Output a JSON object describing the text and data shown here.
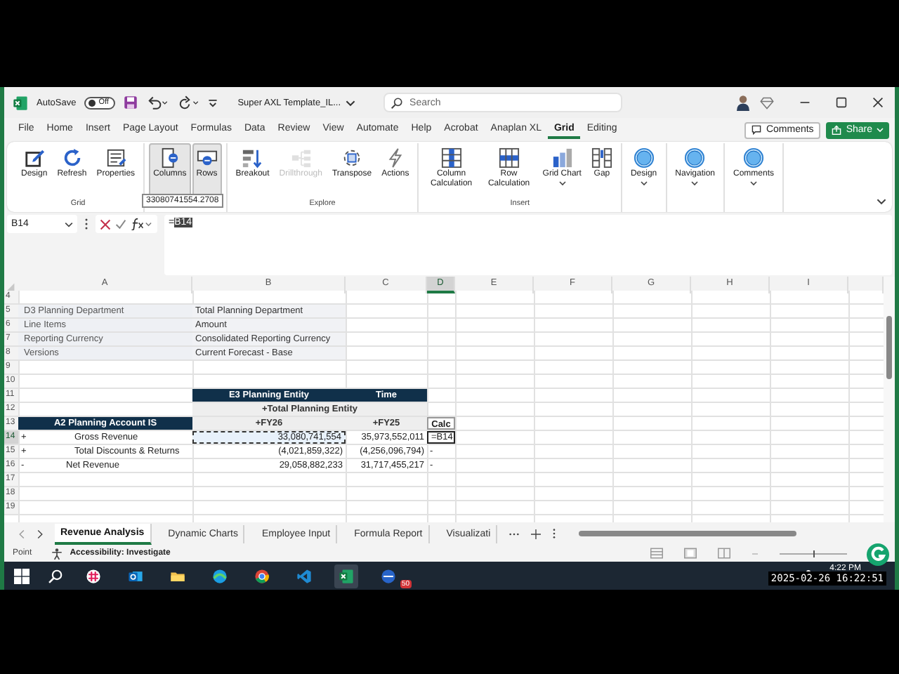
{
  "window": {
    "title": "Super AXL Template_IL...",
    "autosave": {
      "label": "AutoSave",
      "on": false,
      "state_label": "Off"
    },
    "search": {
      "placeholder": "Search"
    }
  },
  "menu": [
    {
      "label": "File",
      "selected": false
    },
    {
      "label": "Home",
      "selected": false
    },
    {
      "label": "Insert",
      "selected": false
    },
    {
      "label": "Page Layout",
      "selected": false
    },
    {
      "label": "Formulas",
      "selected": false
    },
    {
      "label": "Data",
      "selected": false
    },
    {
      "label": "Review",
      "selected": false
    },
    {
      "label": "View",
      "selected": false
    },
    {
      "label": "Automate",
      "selected": false
    },
    {
      "label": "Help",
      "selected": false
    },
    {
      "label": "Acrobat",
      "selected": false
    },
    {
      "label": "Anaplan XL",
      "selected": false
    },
    {
      "label": "Grid",
      "selected": true
    },
    {
      "label": "Editing",
      "selected": false
    }
  ],
  "header_buttons": [
    {
      "label": "Comments",
      "kind": "outline"
    },
    {
      "label": "Share",
      "kind": "primary"
    }
  ],
  "ribbon": {
    "groups": [
      {
        "label": "Grid",
        "items": [
          {
            "label": "Design",
            "disabled": false,
            "pressed": false,
            "dropdown": false
          },
          {
            "label": "Refresh",
            "disabled": false,
            "pressed": false,
            "dropdown": false
          },
          {
            "label": "Properties",
            "disabled": false,
            "pressed": false,
            "dropdown": false
          }
        ]
      },
      {
        "items": [
          {
            "label": "Columns",
            "disabled": false,
            "pressed": true,
            "dropdown": false
          },
          {
            "label": "Rows",
            "disabled": false,
            "pressed": true,
            "dropdown": false
          }
        ]
      },
      {
        "label": "Explore",
        "items": [
          {
            "label": "Breakout",
            "disabled": false,
            "pressed": false,
            "dropdown": false
          },
          {
            "label": "Drillthrough",
            "disabled": true,
            "pressed": false,
            "dropdown": false
          },
          {
            "label": "Transpose",
            "disabled": false,
            "pressed": false,
            "dropdown": false
          },
          {
            "label": "Actions",
            "disabled": false,
            "pressed": false,
            "dropdown": false
          }
        ]
      },
      {
        "label": "Insert",
        "items": [
          {
            "label": "Column Calculation",
            "disabled": false,
            "pressed": false,
            "dropdown": false
          },
          {
            "label": "Row Calculation",
            "disabled": false,
            "pressed": false,
            "dropdown": false
          },
          {
            "label": "Grid Chart",
            "disabled": false,
            "pressed": false,
            "dropdown": true
          },
          {
            "label": "Gap",
            "disabled": false,
            "pressed": false,
            "dropdown": false
          }
        ]
      },
      {
        "items": [
          {
            "label": "Design",
            "disabled": false,
            "pressed": false,
            "dropdown": true
          }
        ]
      },
      {
        "items": [
          {
            "label": "Navigation",
            "disabled": false,
            "pressed": false,
            "dropdown": true
          }
        ]
      },
      {
        "items": [
          {
            "label": "Comments",
            "disabled": false,
            "pressed": false,
            "dropdown": true
          }
        ]
      }
    ]
  },
  "tooltip": "33080741554.2708",
  "formula_bar": {
    "name_box": "B14",
    "formula": [
      {
        "text": "=",
        "selected": false
      },
      {
        "text": "B14",
        "selected": true
      }
    ]
  },
  "sheet": {
    "columns": [
      {
        "label": "A",
        "selected": false
      },
      {
        "label": "B",
        "selected": false
      },
      {
        "label": "C",
        "selected": false
      },
      {
        "label": "D",
        "selected": true
      },
      {
        "label": "E",
        "selected": false
      },
      {
        "label": "F",
        "selected": false
      },
      {
        "label": "G",
        "selected": false
      },
      {
        "label": "H",
        "selected": false
      },
      {
        "label": "I",
        "selected": false
      }
    ],
    "rows": [
      {
        "number": "4",
        "selected": false
      },
      {
        "number": "5",
        "selected": false,
        "A": {
          "kind": "label",
          "text": "D3 Planning Department"
        },
        "B": {
          "kind": "value",
          "text": "Total Planning Department"
        }
      },
      {
        "number": "6",
        "selected": false,
        "A": {
          "kind": "label",
          "text": "Line Items"
        },
        "B": {
          "kind": "value",
          "text": "Amount"
        }
      },
      {
        "number": "7",
        "selected": false,
        "A": {
          "kind": "label",
          "text": "Reporting Currency"
        },
        "B": {
          "kind": "value",
          "text": "Consolidated Reporting Currency"
        }
      },
      {
        "number": "8",
        "selected": false,
        "A": {
          "kind": "label",
          "text": "Versions"
        },
        "B": {
          "kind": "value",
          "text": "Current Forecast - Base"
        }
      },
      {
        "number": "9",
        "selected": false
      },
      {
        "number": "10",
        "selected": false
      },
      {
        "number": "11",
        "selected": false,
        "B": {
          "kind": "dim-header",
          "text": "E3 Planning Entity"
        },
        "C": {
          "kind": "dim-header",
          "text": "Time"
        }
      },
      {
        "number": "12",
        "selected": false,
        "B": {
          "kind": "member-wide",
          "text": "+Total Planning Entity"
        }
      },
      {
        "number": "13",
        "selected": false,
        "A": {
          "kind": "dim-header",
          "text": "A2 Planning Account IS"
        },
        "B": {
          "kind": "member",
          "text": "+FY26"
        },
        "C": {
          "kind": "member",
          "text": "+FY25"
        },
        "D": {
          "kind": "calc-header",
          "text": "Calc"
        }
      },
      {
        "number": "14",
        "selected": true,
        "A": {
          "kind": "account-detail",
          "marker": "+",
          "text": "Gross Revenue"
        },
        "B": {
          "kind": "number",
          "text": "33,080,741,554",
          "referenced": true
        },
        "C": {
          "kind": "number",
          "text": "35,973,552,011"
        },
        "D": {
          "kind": "calc",
          "text": "=B14",
          "editing": true
        }
      },
      {
        "number": "15",
        "selected": false,
        "A": {
          "kind": "account-detail",
          "marker": "+",
          "text": "Total Discounts & Returns"
        },
        "B": {
          "kind": "number",
          "text": "(4,021,859,322)"
        },
        "C": {
          "kind": "number",
          "text": "(4,256,096,794)"
        },
        "D": {
          "kind": "calc",
          "text": "-"
        }
      },
      {
        "number": "16",
        "selected": false,
        "A": {
          "kind": "account-total",
          "marker": "-",
          "text": "Net Revenue"
        },
        "B": {
          "kind": "number",
          "text": "29,058,882,233"
        },
        "C": {
          "kind": "number",
          "text": "31,717,455,217"
        },
        "D": {
          "kind": "calc",
          "text": "-"
        }
      },
      {
        "number": "17",
        "selected": false
      },
      {
        "number": "18",
        "selected": false
      },
      {
        "number": "19",
        "selected": false
      }
    ]
  },
  "sheet_tabs": [
    {
      "label": "Revenue Analysis",
      "selected": true
    },
    {
      "label": "Dynamic Charts",
      "selected": false
    },
    {
      "label": "Employee Input",
      "selected": false
    },
    {
      "label": "Formula Report",
      "selected": false
    },
    {
      "label": "Visualizati",
      "selected": false
    }
  ],
  "status_bar": {
    "mode": "Point",
    "accessibility": "Accessibility: Investigate",
    "zoom": {
      "level": 0.5
    }
  },
  "taskbar": {
    "apps": [
      {
        "active": false
      },
      {
        "active": false
      },
      {
        "active": false
      },
      {
        "active": false
      },
      {
        "active": false
      },
      {
        "active": false
      },
      {
        "active": true
      },
      {
        "active": false,
        "badge": "50"
      }
    ],
    "time": "4:22 PM"
  },
  "overlay_timestamp": "2025-02-26 16:22:51"
}
